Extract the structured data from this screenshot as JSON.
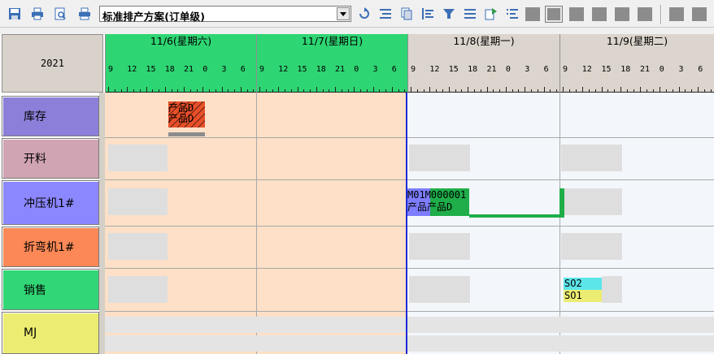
{
  "toolbar": {
    "plan_select": {
      "value": "标准排产方案(订单级)"
    },
    "buttons": [
      "save-icon",
      "print-icon",
      "preview-icon",
      "printer-setup-icon",
      "refresh-icon",
      "align-icon",
      "copy-icon",
      "indent-icon",
      "filter-icon",
      "list-icon",
      "export-icon",
      "sort-icon"
    ]
  },
  "gantt": {
    "corner": {
      "year": "2021"
    },
    "days": [
      {
        "title": "11/6(星期六)",
        "color": "#2ed573"
      },
      {
        "title": "11/7(星期日)",
        "color": "#2ed573"
      },
      {
        "title": "11/8(星期一)",
        "color": "#dcd5cd"
      },
      {
        "title": "11/9(星期二)",
        "color": "#dcd5cd"
      }
    ],
    "hour_labels": [
      "9",
      "12",
      "15",
      "18",
      "21",
      "0",
      "3",
      "6"
    ],
    "rows": [
      {
        "label": "库存",
        "color": "#8b7fd9"
      },
      {
        "label": "开料",
        "color": "#d0a4b2"
      },
      {
        "label": "冲压机1#",
        "color": "#8b87ff"
      },
      {
        "label": "折弯机1#",
        "color": "#fb8856"
      },
      {
        "label": "销售",
        "color": "#31d776"
      },
      {
        "label": "MJ",
        "color": "#ecec72"
      }
    ],
    "tasks": {
      "inventory": {
        "line1": "产品D",
        "line2": "产品D",
        "color": "#e8502a"
      },
      "stamping": {
        "line1": "M01M000001",
        "line2": "产品产品D",
        "color": "#1fae4a",
        "color2": "#7d7dff"
      },
      "sales": {
        "so2": "SO2",
        "so1": "SO1",
        "so2_color": "#5ce6ea",
        "so1_color": "#ecec72"
      }
    },
    "colors": {
      "past_bg": "#fde0c7",
      "future_bg": "#f3f7fc",
      "now_line": "#1d2bd6"
    }
  }
}
